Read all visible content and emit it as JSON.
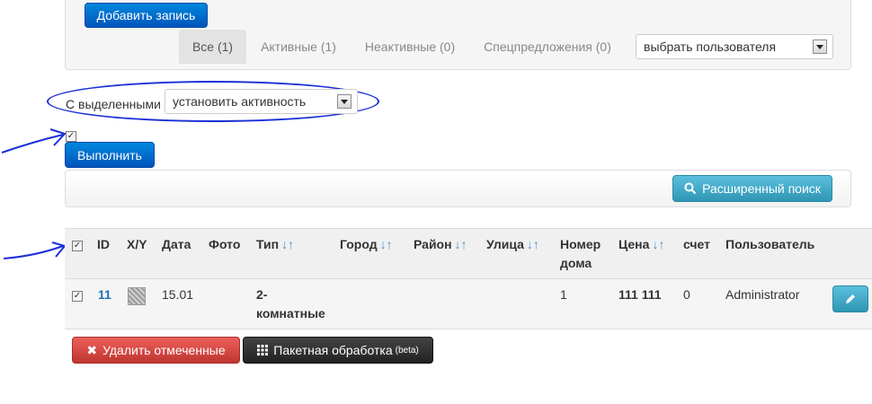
{
  "toolbar": {
    "add_label": "Добавить запись"
  },
  "tabs": [
    {
      "label": "Все (1)",
      "active": true
    },
    {
      "label": "Активные (1)",
      "active": false
    },
    {
      "label": "Неактивные (0)",
      "active": false
    },
    {
      "label": "Спецпредложения (0)",
      "active": false
    }
  ],
  "user_select": {
    "value": "выбрать пользователя"
  },
  "bulk": {
    "label": "С выделенными",
    "action_value": "установить активность",
    "execute_label": "Выполнить"
  },
  "search": {
    "advanced_label": "Расширенный поиск"
  },
  "table": {
    "headers": {
      "id": "ID",
      "xy": "X/Y",
      "date": "Дата",
      "photo": "Фото",
      "type": "Тип",
      "city": "Город",
      "district": "Район",
      "street": "Улица",
      "house_l1": "Номер",
      "house_l2": "дома",
      "price": "Цена",
      "account": "счет",
      "user": "Пользователь"
    },
    "sort_glyph": "↓↑",
    "row": {
      "id": "11",
      "date": "15.01",
      "type_l1": "2-",
      "type_l2": "комнатные",
      "house": "1",
      "price": "111 111",
      "account": "0",
      "user": "Administrator"
    }
  },
  "actions": {
    "delete_label": "Удалить отмеченные",
    "batch_label": "Пакетная обработка",
    "batch_sup": "(beta)"
  },
  "icons": {
    "search": "search-icon",
    "pencil": "pencil-icon",
    "close": "close-icon",
    "grid": "grid-icon",
    "photo": "photo-thumbnail-icon"
  },
  "colors": {
    "primary": "#0066cc",
    "info": "#49afcd",
    "danger": "#da4f49",
    "inverse": "#333333",
    "annotation": "#1a2fd8"
  }
}
